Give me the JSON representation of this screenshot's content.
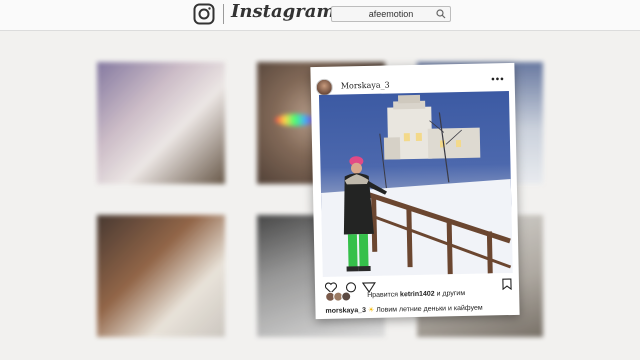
{
  "header": {
    "wordmark": "Instagram",
    "search_value": "afeemotion"
  },
  "post": {
    "username": "Morskaya_3",
    "liked_by_prefix": "Нравится",
    "liked_by_user": "ketrin1402",
    "liked_by_suffix": "и другим",
    "caption_user": "morskaya_3",
    "caption_text": "Ловим летние деньки и кайфуем"
  },
  "icons": [
    "instagram-logo-icon",
    "search-icon",
    "more-dots-icon",
    "heart-icon",
    "comment-icon",
    "share-icon",
    "bookmark-icon"
  ],
  "colors": {
    "topbar": "#fafafa",
    "page": "#f2f1ef",
    "card": "#ffffff"
  }
}
